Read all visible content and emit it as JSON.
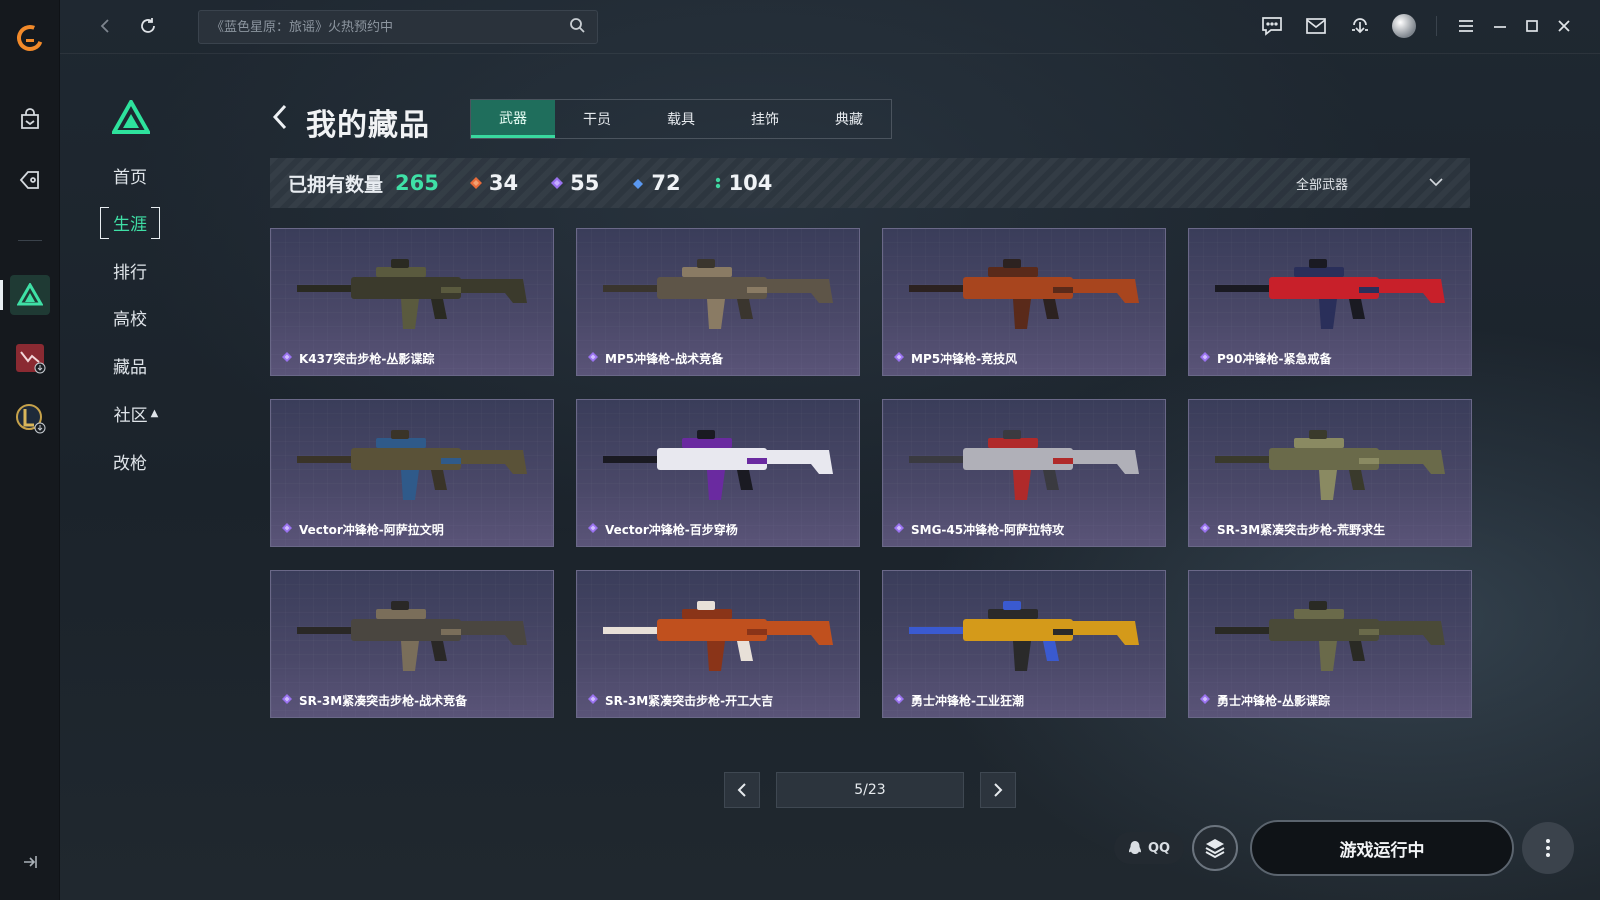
{
  "app": {
    "search_placeholder": "《蓝色星原：旅谣》火热预约中"
  },
  "rail": {
    "icons": [
      "logo-icon",
      "store-icon",
      "tag-icon",
      "game-triangle-icon",
      "valorant-icon",
      "lol-icon",
      "collapse-icon"
    ]
  },
  "nav": {
    "items": [
      "首页",
      "生涯",
      "排行",
      "高校",
      "藏品",
      "社区",
      "改枪"
    ],
    "active": "生涯"
  },
  "header": {
    "title": "我的藏品",
    "tabs": [
      "武器",
      "干员",
      "载具",
      "挂饰",
      "典藏"
    ],
    "active_tab": "武器"
  },
  "stats": {
    "owned_label": "已拥有数量",
    "owned_count": "265",
    "rarities": [
      {
        "value": "34",
        "color": "#e86b3a"
      },
      {
        "value": "55",
        "color": "#9a72f0"
      },
      {
        "value": "72",
        "color": "#5a98f0"
      },
      {
        "value": "104",
        "color": "#3fd6a0"
      }
    ],
    "filter_label": "全部武器"
  },
  "items": [
    {
      "name": "K437突击步枪-丛影谍踪",
      "colors": [
        "#3b3a2c",
        "#5a5a3e",
        "#2a2a22"
      ]
    },
    {
      "name": "MP5冲锋枪-战术竞备",
      "colors": [
        "#5e5548",
        "#8a7b64",
        "#3a352e"
      ]
    },
    {
      "name": "MP5冲锋枪-竞技风",
      "colors": [
        "#a8451e",
        "#5a2a1a",
        "#2c2220"
      ]
    },
    {
      "name": "P90冲锋枪-紧急戒备",
      "colors": [
        "#c8202a",
        "#2a2f5a",
        "#1a1a22"
      ]
    },
    {
      "name": "Vector冲锋枪-阿萨拉文明",
      "colors": [
        "#5a5238",
        "#2f5a8a",
        "#3a3428"
      ]
    },
    {
      "name": "Vector冲锋枪-百步穿杨",
      "colors": [
        "#e8e8ef",
        "#6a2aa0",
        "#1a1a22"
      ]
    },
    {
      "name": "SMG-45冲锋枪-阿萨拉特攻",
      "colors": [
        "#b0b0b8",
        "#b02a2a",
        "#3a3a40"
      ]
    },
    {
      "name": "SR-3M紧凑突击步枪-荒野求生",
      "colors": [
        "#6a6a4a",
        "#8a8a62",
        "#3a3a2c"
      ]
    },
    {
      "name": "SR-3M紧凑突击步枪-战术竞备",
      "colors": [
        "#4a4640",
        "#7a6e5a",
        "#2a2826"
      ]
    },
    {
      "name": "SR-3M紧凑突击步枪-开工大吉",
      "colors": [
        "#c0501e",
        "#8a3418",
        "#e8e0d8"
      ]
    },
    {
      "name": "勇士冲锋枪-工业狂潮",
      "colors": [
        "#d49a1a",
        "#2a2a2a",
        "#3a5ad0"
      ]
    },
    {
      "name": "勇士冲锋枪-丛影谍踪",
      "colors": [
        "#4a4a38",
        "#6a6a4a",
        "#2a2a24"
      ]
    }
  ],
  "pagination": {
    "indicator": "5/23"
  },
  "bottom": {
    "qq_label": "QQ",
    "run_label": "游戏运行中"
  }
}
